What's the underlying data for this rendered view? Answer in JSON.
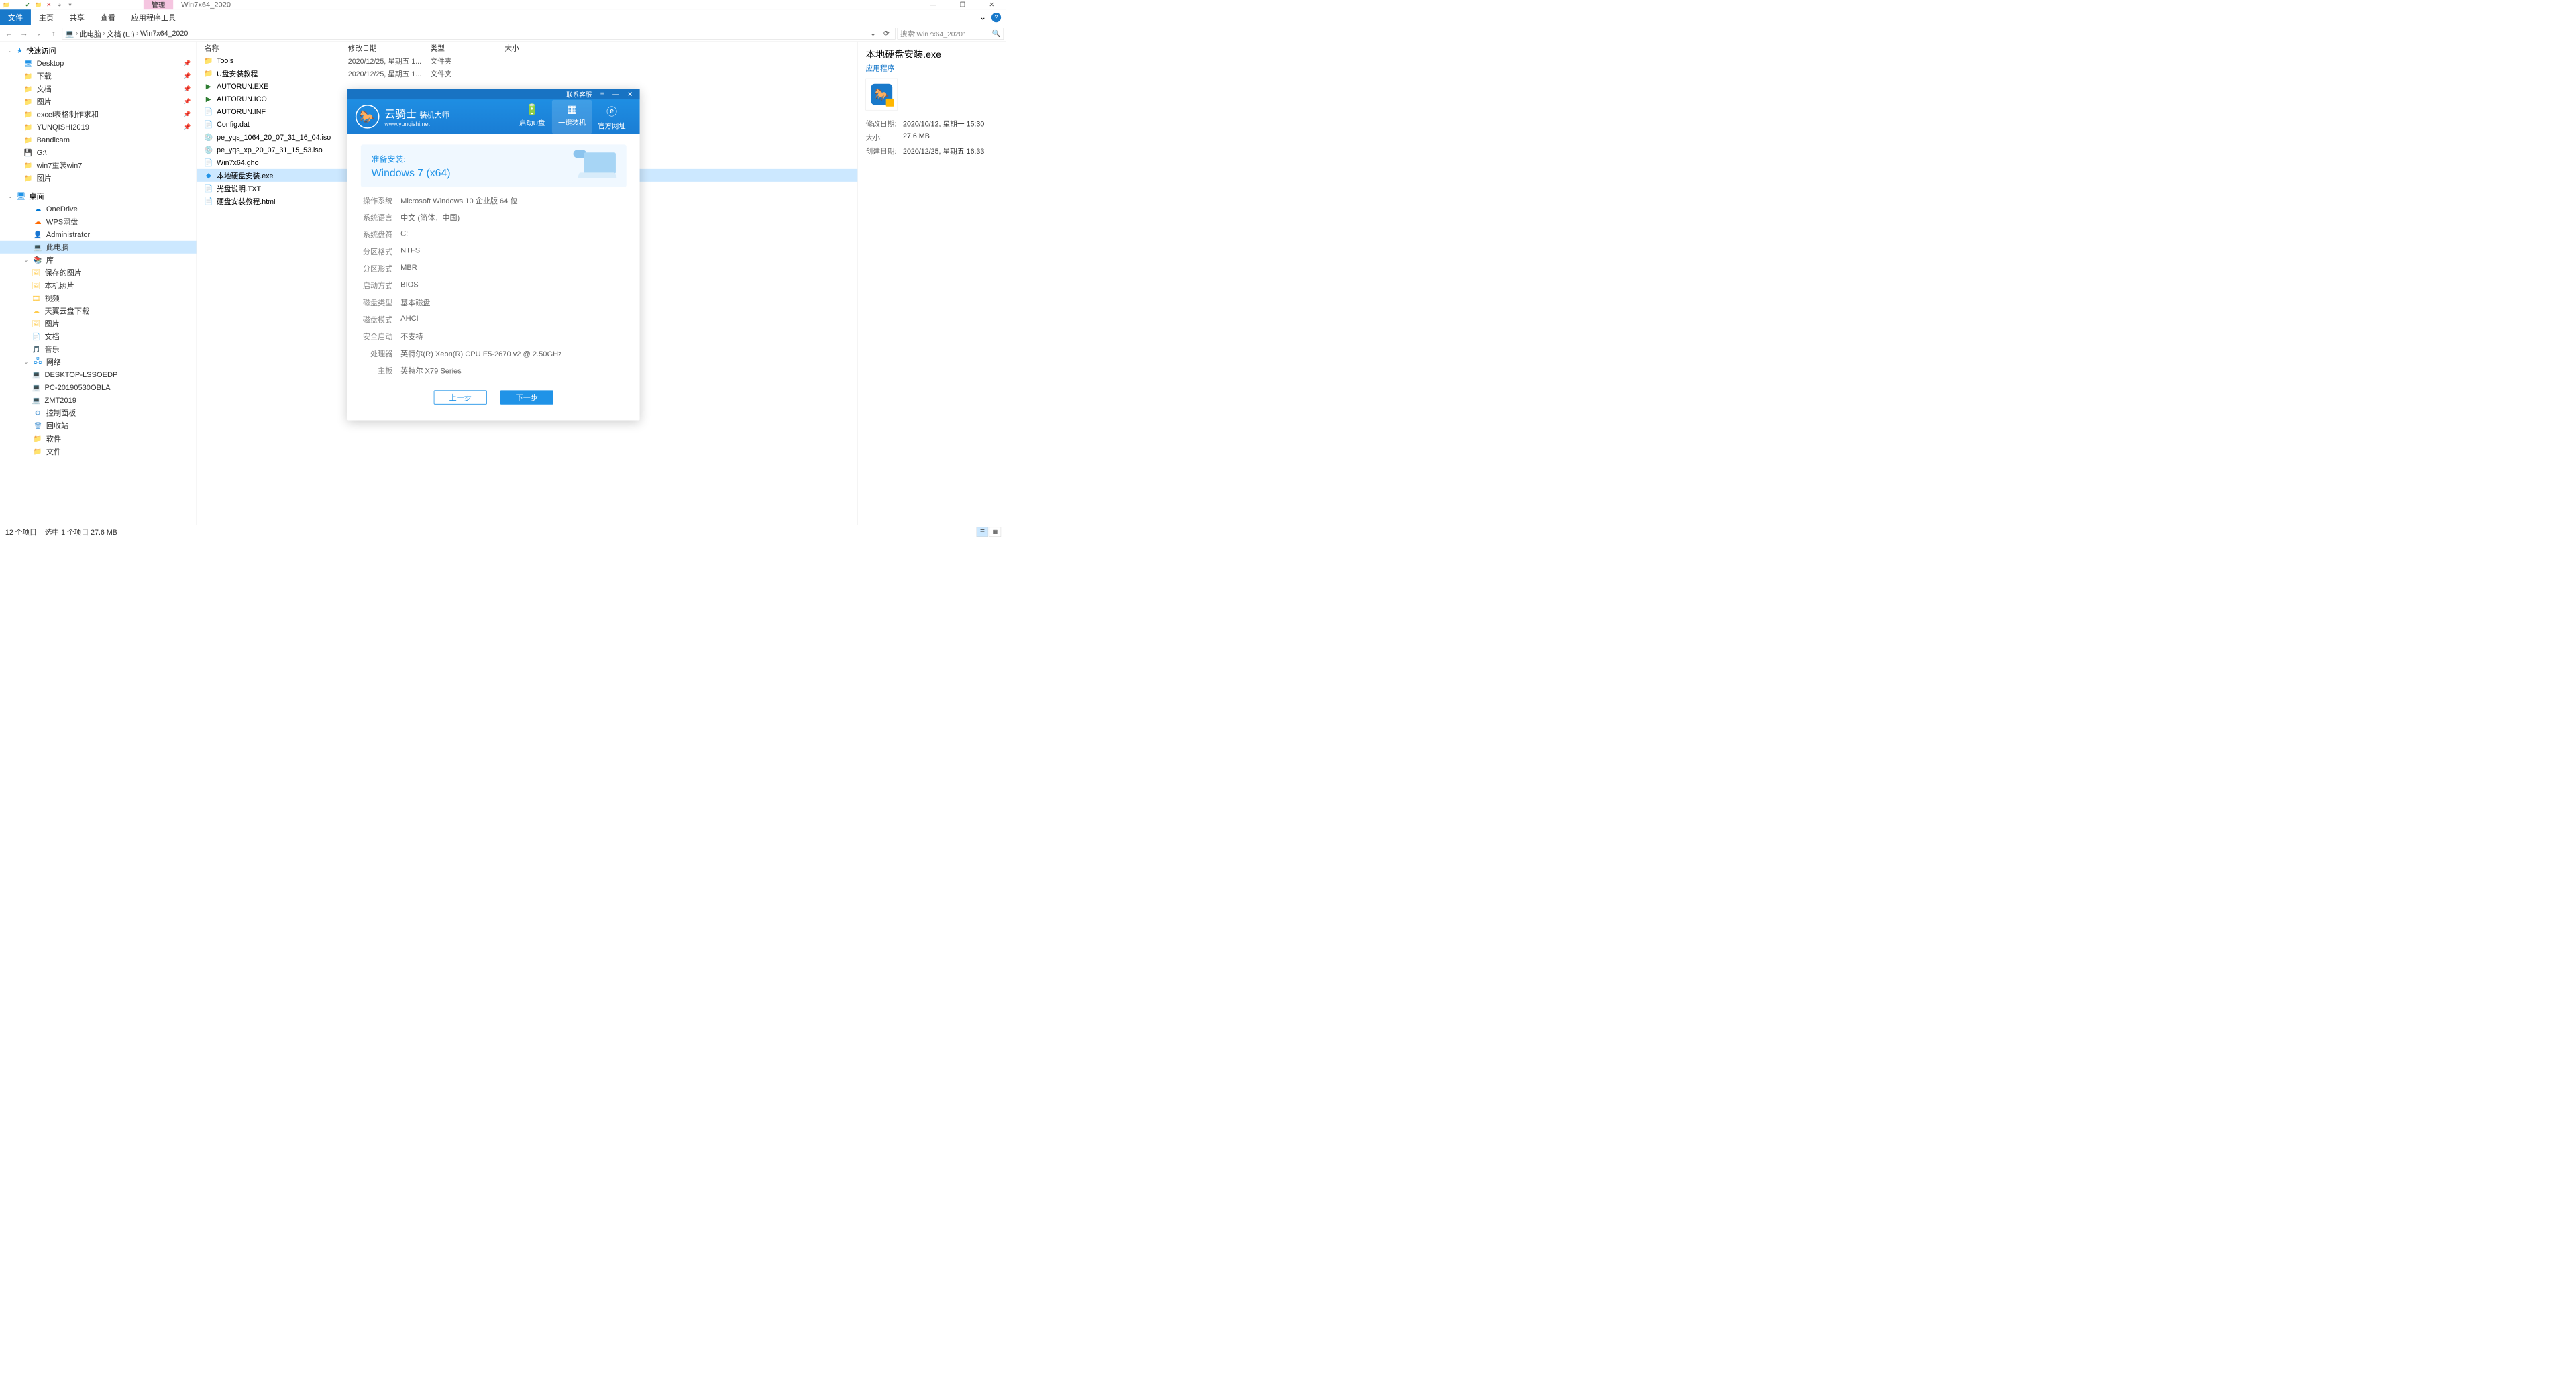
{
  "window": {
    "title": "Win7x64_2020",
    "contextual_tab": "管理"
  },
  "ribbon": {
    "file": "文件",
    "tabs": [
      "主页",
      "共享",
      "查看",
      "应用程序工具"
    ],
    "expand_icon": "⌄",
    "help_icon": "?"
  },
  "addressbar": {
    "back": "←",
    "forward": "→",
    "up": "↑",
    "crumbs": [
      "此电脑",
      "文档 (E:)",
      "Win7x64_2020"
    ],
    "refresh": "⟳",
    "dropdown": "⌄"
  },
  "search": {
    "placeholder": "搜索\"Win7x64_2020\"",
    "icon": "🔍"
  },
  "nav": {
    "quick_access": "快速访问",
    "quick_items": [
      {
        "label": "Desktop",
        "icon": "🖥",
        "cls": "ic-desktop",
        "pin": true
      },
      {
        "label": "下载",
        "icon": "📁",
        "cls": "ic-folder",
        "pin": true
      },
      {
        "label": "文档",
        "icon": "📁",
        "cls": "ic-folder",
        "pin": true
      },
      {
        "label": "图片",
        "icon": "📁",
        "cls": "ic-folder",
        "pin": true
      },
      {
        "label": "excel表格制作求和",
        "icon": "📁",
        "cls": "ic-folder",
        "pin": true
      },
      {
        "label": "YUNQISHI2019",
        "icon": "📁",
        "cls": "ic-folder",
        "pin": true
      },
      {
        "label": "Bandicam",
        "icon": "📁",
        "cls": "ic-folder"
      },
      {
        "label": "G:\\",
        "icon": "💾",
        "cls": "ic-disk"
      },
      {
        "label": "win7重装win7",
        "icon": "📁",
        "cls": "ic-folder"
      },
      {
        "label": "图片",
        "icon": "📁",
        "cls": "ic-folder"
      }
    ],
    "desktop": "桌面",
    "desktop_items": [
      {
        "label": "OneDrive",
        "icon": "☁",
        "cls": "ic-onedrive"
      },
      {
        "label": "WPS网盘",
        "icon": "☁",
        "cls": "ic-wps"
      },
      {
        "label": "Administrator",
        "icon": "👤",
        "cls": "ic-user"
      },
      {
        "label": "此电脑",
        "icon": "💻",
        "cls": "ic-thispc",
        "selected": true
      },
      {
        "label": "库",
        "icon": "📚",
        "cls": "ic-lib",
        "expandable": true
      }
    ],
    "lib_items": [
      {
        "label": "保存的图片",
        "icon": "🖼",
        "cls": "ic-folder"
      },
      {
        "label": "本机照片",
        "icon": "🖼",
        "cls": "ic-folder"
      },
      {
        "label": "视频",
        "icon": "🎞",
        "cls": "ic-folder"
      },
      {
        "label": "天翼云盘下载",
        "icon": "☁",
        "cls": "ic-folder"
      },
      {
        "label": "图片",
        "icon": "🖼",
        "cls": "ic-folder"
      },
      {
        "label": "文档",
        "icon": "📄",
        "cls": "ic-folder"
      },
      {
        "label": "音乐",
        "icon": "🎵",
        "cls": "ic-folder"
      }
    ],
    "network": "网络",
    "network_items": [
      {
        "label": "DESKTOP-LSSOEDP",
        "icon": "💻",
        "cls": "ic-thispc"
      },
      {
        "label": "PC-20190530OBLA",
        "icon": "💻",
        "cls": "ic-thispc"
      },
      {
        "label": "ZMT2019",
        "icon": "💻",
        "cls": "ic-thispc"
      }
    ],
    "extras": [
      {
        "label": "控制面板",
        "icon": "⚙",
        "cls": "ic-panel"
      },
      {
        "label": "回收站",
        "icon": "🗑",
        "cls": "ic-recycle"
      },
      {
        "label": "软件",
        "icon": "📁",
        "cls": "ic-folder"
      },
      {
        "label": "文件",
        "icon": "📁",
        "cls": "ic-folder"
      }
    ]
  },
  "columns": {
    "name": "名称",
    "date": "修改日期",
    "type": "类型",
    "size": "大小"
  },
  "files": [
    {
      "name": "Tools",
      "date": "2020/12/25, 星期五 1...",
      "type": "文件夹",
      "icon": "📁",
      "cls": "ic-folder"
    },
    {
      "name": "U盘安装教程",
      "date": "2020/12/25, 星期五 1...",
      "type": "文件夹",
      "icon": "📁",
      "cls": "ic-folder"
    },
    {
      "name": "AUTORUN.EXE",
      "date": "",
      "type": "",
      "icon": "▶",
      "cls": "ic-autorun"
    },
    {
      "name": "AUTORUN.ICO",
      "date": "",
      "type": "",
      "icon": "▶",
      "cls": "ic-autorun"
    },
    {
      "name": "AUTORUN.INF",
      "date": "",
      "type": "",
      "icon": "📄",
      "cls": "ic-cfg"
    },
    {
      "name": "Config.dat",
      "date": "",
      "type": "",
      "icon": "📄",
      "cls": "ic-cfg"
    },
    {
      "name": "pe_yqs_1064_20_07_31_16_04.iso",
      "date": "",
      "type": "",
      "icon": "💿",
      "cls": "ic-iso"
    },
    {
      "name": "pe_yqs_xp_20_07_31_15_53.iso",
      "date": "",
      "type": "",
      "icon": "💿",
      "cls": "ic-iso"
    },
    {
      "name": "Win7x64.gho",
      "date": "",
      "type": "",
      "icon": "📄",
      "cls": "ic-cfg"
    },
    {
      "name": "本地硬盘安装.exe",
      "date": "",
      "type": "",
      "icon": "◆",
      "cls": "ic-app",
      "selected": true
    },
    {
      "name": "光盘说明.TXT",
      "date": "",
      "type": "",
      "icon": "📄",
      "cls": "ic-txt"
    },
    {
      "name": "硬盘安装教程.html",
      "date": "",
      "type": "",
      "icon": "📄",
      "cls": "ic-html"
    }
  ],
  "details": {
    "title": "本地硬盘安装.exe",
    "subtitle": "应用程序",
    "rows": [
      {
        "label": "修改日期:",
        "value": "2020/10/12, 星期一 15:30"
      },
      {
        "label": "大小:",
        "value": "27.6 MB"
      },
      {
        "label": "创建日期:",
        "value": "2020/12/25, 星期五 16:33"
      }
    ]
  },
  "statusbar": {
    "count": "12 个项目",
    "selection": "选中 1 个项目  27.6 MB"
  },
  "yqs": {
    "contact": "联系客服",
    "menu_icon": "≡",
    "min_icon": "—",
    "close_icon": "✕",
    "logo_glyph": "🐎",
    "brand": "云骑士",
    "brand_suffix": "装机大师",
    "url": "www.yunqishi.net",
    "tabs": [
      {
        "icon": "🔋",
        "label": "启动U盘"
      },
      {
        "icon": "▦",
        "label": "一键装机",
        "active": true
      },
      {
        "icon": "ⓔ",
        "label": "官方网址"
      }
    ],
    "prepare_label": "准备安装:",
    "prepare_os": "Windows 7 (x64)",
    "info": [
      {
        "label": "操作系统",
        "value": "Microsoft Windows 10 企业版 64 位"
      },
      {
        "label": "系统语言",
        "value": "中文 (简体，中国)"
      },
      {
        "label": "系统盘符",
        "value": "C:"
      },
      {
        "label": "分区格式",
        "value": "NTFS"
      },
      {
        "label": "分区形式",
        "value": "MBR"
      },
      {
        "label": "启动方式",
        "value": "BIOS"
      },
      {
        "label": "磁盘类型",
        "value": "基本磁盘"
      },
      {
        "label": "磁盘模式",
        "value": "AHCI"
      },
      {
        "label": "安全启动",
        "value": "不支持"
      },
      {
        "label": "处理器",
        "value": "英特尔(R) Xeon(R) CPU E5-2670 v2 @ 2.50GHz"
      },
      {
        "label": "主板",
        "value": "英特尔 X79 Series"
      }
    ],
    "prev": "上一步",
    "next": "下一步"
  }
}
